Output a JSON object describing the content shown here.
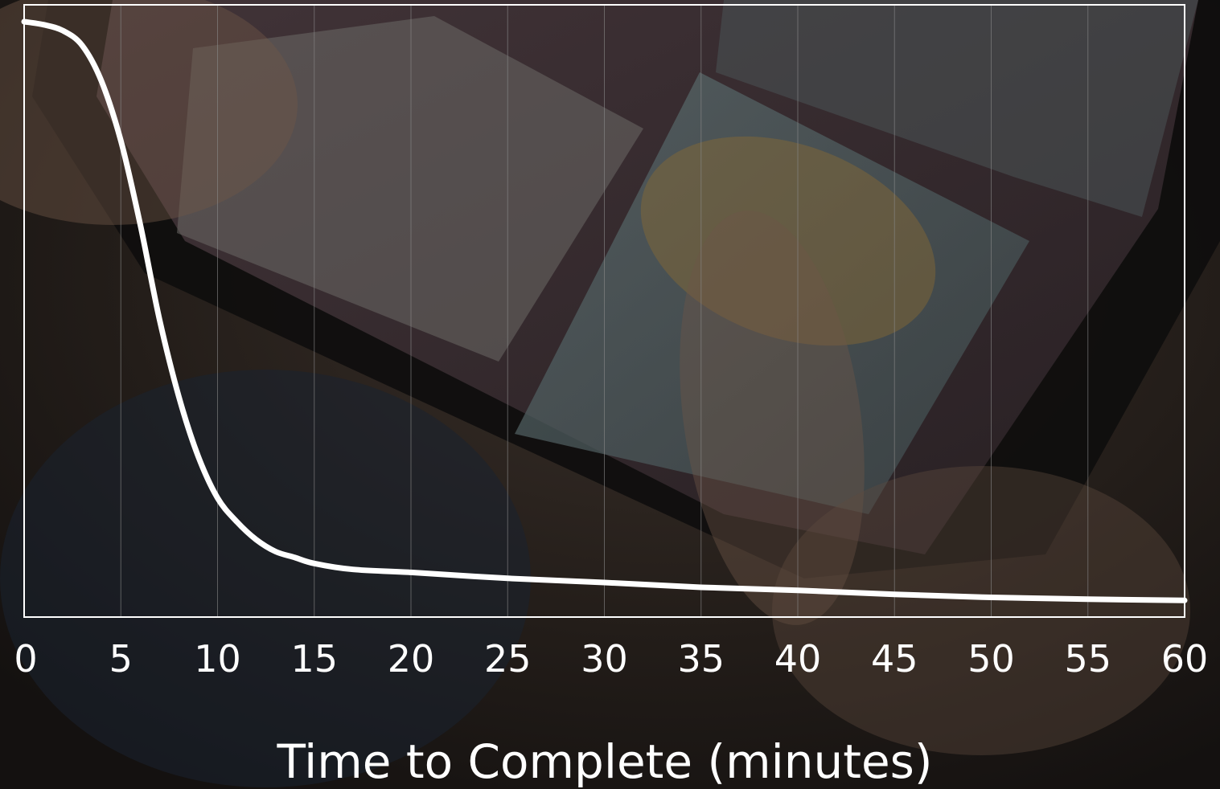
{
  "chart_data": {
    "type": "line",
    "title": "",
    "xlabel": "Time to Complete (minutes)",
    "ylabel": "",
    "xlim": [
      0,
      60
    ],
    "ylim": [
      0,
      1
    ],
    "x_ticks": [
      "0",
      "5",
      "10",
      "15",
      "20",
      "25",
      "30",
      "35",
      "40",
      "45",
      "50",
      "55",
      "60"
    ],
    "grid": "vertical",
    "series": [
      {
        "x": [
          0,
          1,
          2,
          3,
          4,
          5,
          6,
          7,
          8,
          9,
          10,
          11,
          12,
          13,
          14,
          15,
          17,
          20,
          25,
          30,
          35,
          40,
          45,
          50,
          55,
          60
        ],
        "y": [
          1.0,
          0.995,
          0.985,
          0.96,
          0.9,
          0.8,
          0.66,
          0.5,
          0.37,
          0.27,
          0.2,
          0.16,
          0.13,
          0.11,
          0.1,
          0.09,
          0.08,
          0.075,
          0.065,
          0.058,
          0.05,
          0.045,
          0.038,
          0.033,
          0.03,
          0.028
        ]
      }
    ]
  },
  "colors": {
    "line": "#ffffff",
    "axes": "#ffffff",
    "grid": "#8a8a8a"
  }
}
